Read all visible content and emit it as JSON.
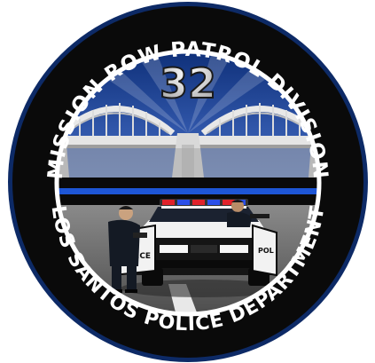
{
  "emblem": {
    "top_text": "MISSION ROW PATROL DIVISION",
    "bottom_text": "LOS SANTOS POLICE DEPARTMENT",
    "unit_number": "32",
    "car_door_left": "POLICE",
    "car_door_right": "POL"
  },
  "colors": {
    "outer_ring": "#0a0a0a",
    "ring_border": "#0d2a66",
    "sky_top": "#0e2f78",
    "sky_bottom": "#3a5fb0",
    "thin_blue_line": "#1e56d6",
    "ground": "#6e6e6e",
    "car_body": "#151515",
    "car_door": "#f2f2f2",
    "lightbar_red": "#e0222a",
    "lightbar_blue": "#2b4fe8"
  },
  "icons": [
    "bridge-icon",
    "police-car-icon",
    "officer-icon",
    "lightbar-icon"
  ]
}
